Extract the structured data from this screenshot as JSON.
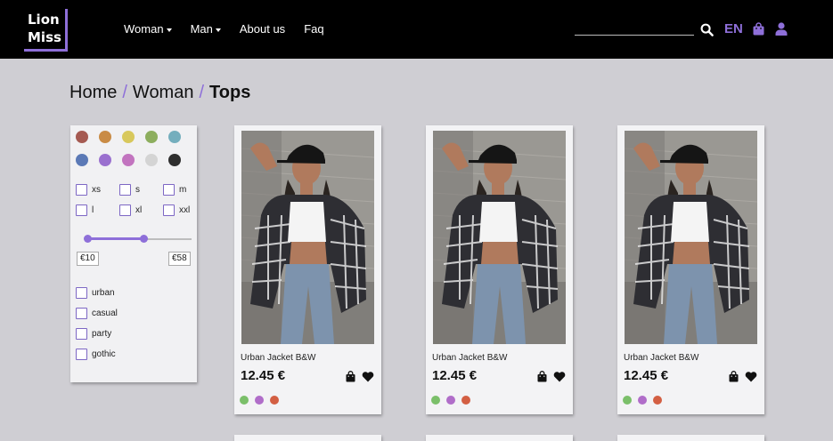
{
  "brand": {
    "line1": "Lion",
    "line2": "Miss"
  },
  "nav": [
    {
      "label": "Woman",
      "dropdown": true
    },
    {
      "label": "Man",
      "dropdown": true
    },
    {
      "label": "About us",
      "dropdown": false
    },
    {
      "label": "Faq",
      "dropdown": false
    }
  ],
  "search": {
    "value": "",
    "placeholder": ""
  },
  "language": "EN",
  "breadcrumb": {
    "items": [
      "Home",
      "Woman"
    ],
    "separator": "/",
    "current": "Tops"
  },
  "colors": {
    "accent": "#8e6fd9",
    "header_bg": "#000000",
    "page_bg": "#cfced3"
  },
  "filters": {
    "color_swatches": [
      "#a55a52",
      "#c98b45",
      "#d8c85c",
      "#8dae5e",
      "#74aebd",
      "#5b79b6",
      "#9a70cf",
      "#c274bf",
      "#d4d4d4",
      "#2e2e2e"
    ],
    "sizes": [
      "xs",
      "s",
      "m",
      "l",
      "xl",
      "xxl"
    ],
    "price": {
      "min_label": "€10",
      "max_label": "€58"
    },
    "styles": [
      "urban",
      "casual",
      "party",
      "gothic"
    ]
  },
  "products": [
    {
      "name": "Urban Jacket B&W",
      "price": "12.45 €",
      "colors": [
        "#7bbf6a",
        "#b06dc9",
        "#d35f43"
      ]
    },
    {
      "name": "Urban Jacket B&W",
      "price": "12.45 €",
      "colors": [
        "#7bbf6a",
        "#b06dc9",
        "#d35f43"
      ]
    },
    {
      "name": "Urban Jacket B&W",
      "price": "12.45 €",
      "colors": [
        "#7bbf6a",
        "#b06dc9",
        "#d35f43"
      ]
    }
  ]
}
